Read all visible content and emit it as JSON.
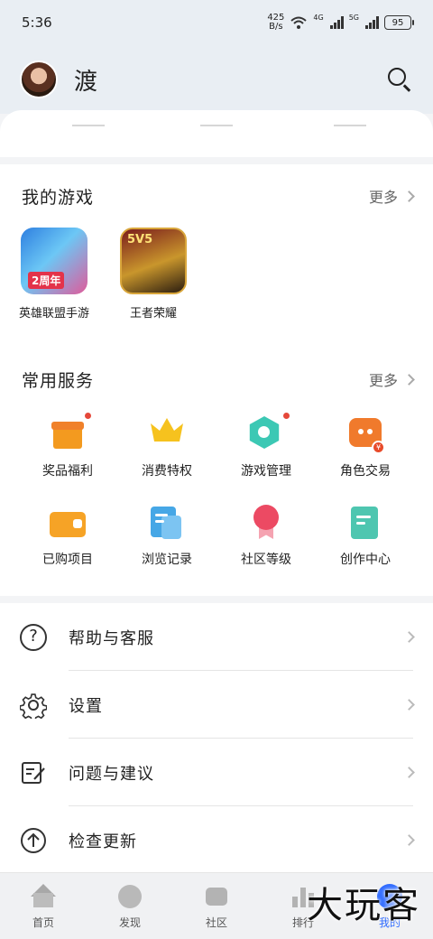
{
  "status_bar": {
    "time": "5:36",
    "net_speed_value": "425",
    "net_speed_unit": "B/s",
    "signal_1_label": "4G",
    "signal_2_label": "5G",
    "battery": "95"
  },
  "header": {
    "username": "渡"
  },
  "my_games": {
    "title": "我的游戏",
    "more_label": "更多",
    "games": [
      {
        "name": "英雄联盟手游",
        "badge": "2周年"
      },
      {
        "name": "王者荣耀",
        "badge": "5V5"
      }
    ]
  },
  "services": {
    "title": "常用服务",
    "more_label": "更多",
    "items": [
      {
        "label": "奖品福利",
        "icon": "gift-icon",
        "has_dot": true
      },
      {
        "label": "消费特权",
        "icon": "crown-icon",
        "has_dot": false
      },
      {
        "label": "游戏管理",
        "icon": "game-manage-icon",
        "has_dot": true
      },
      {
        "label": "角色交易",
        "icon": "trade-chat-icon",
        "has_dot": false
      },
      {
        "label": "已购项目",
        "icon": "wallet-icon",
        "has_dot": false
      },
      {
        "label": "浏览记录",
        "icon": "history-doc-icon",
        "has_dot": false
      },
      {
        "label": "社区等级",
        "icon": "medal-icon",
        "has_dot": false
      },
      {
        "label": "创作中心",
        "icon": "create-pen-icon",
        "has_dot": false
      }
    ]
  },
  "menu": [
    {
      "label": "帮助与客服",
      "icon": "help-icon"
    },
    {
      "label": "设置",
      "icon": "gear-icon"
    },
    {
      "label": "问题与建议",
      "icon": "feedback-icon"
    },
    {
      "label": "检查更新",
      "icon": "update-icon"
    }
  ],
  "bottom_nav": [
    {
      "label": "首页",
      "icon": "home-icon"
    },
    {
      "label": "发现",
      "icon": "discover-icon"
    },
    {
      "label": "社区",
      "icon": "community-icon"
    },
    {
      "label": "排行",
      "icon": "ranking-icon"
    },
    {
      "label": "我的",
      "icon": "mine-icon"
    }
  ],
  "watermark": "大玩客",
  "colors": {
    "accent": "#2f6bff",
    "dot": "#e5483a"
  }
}
